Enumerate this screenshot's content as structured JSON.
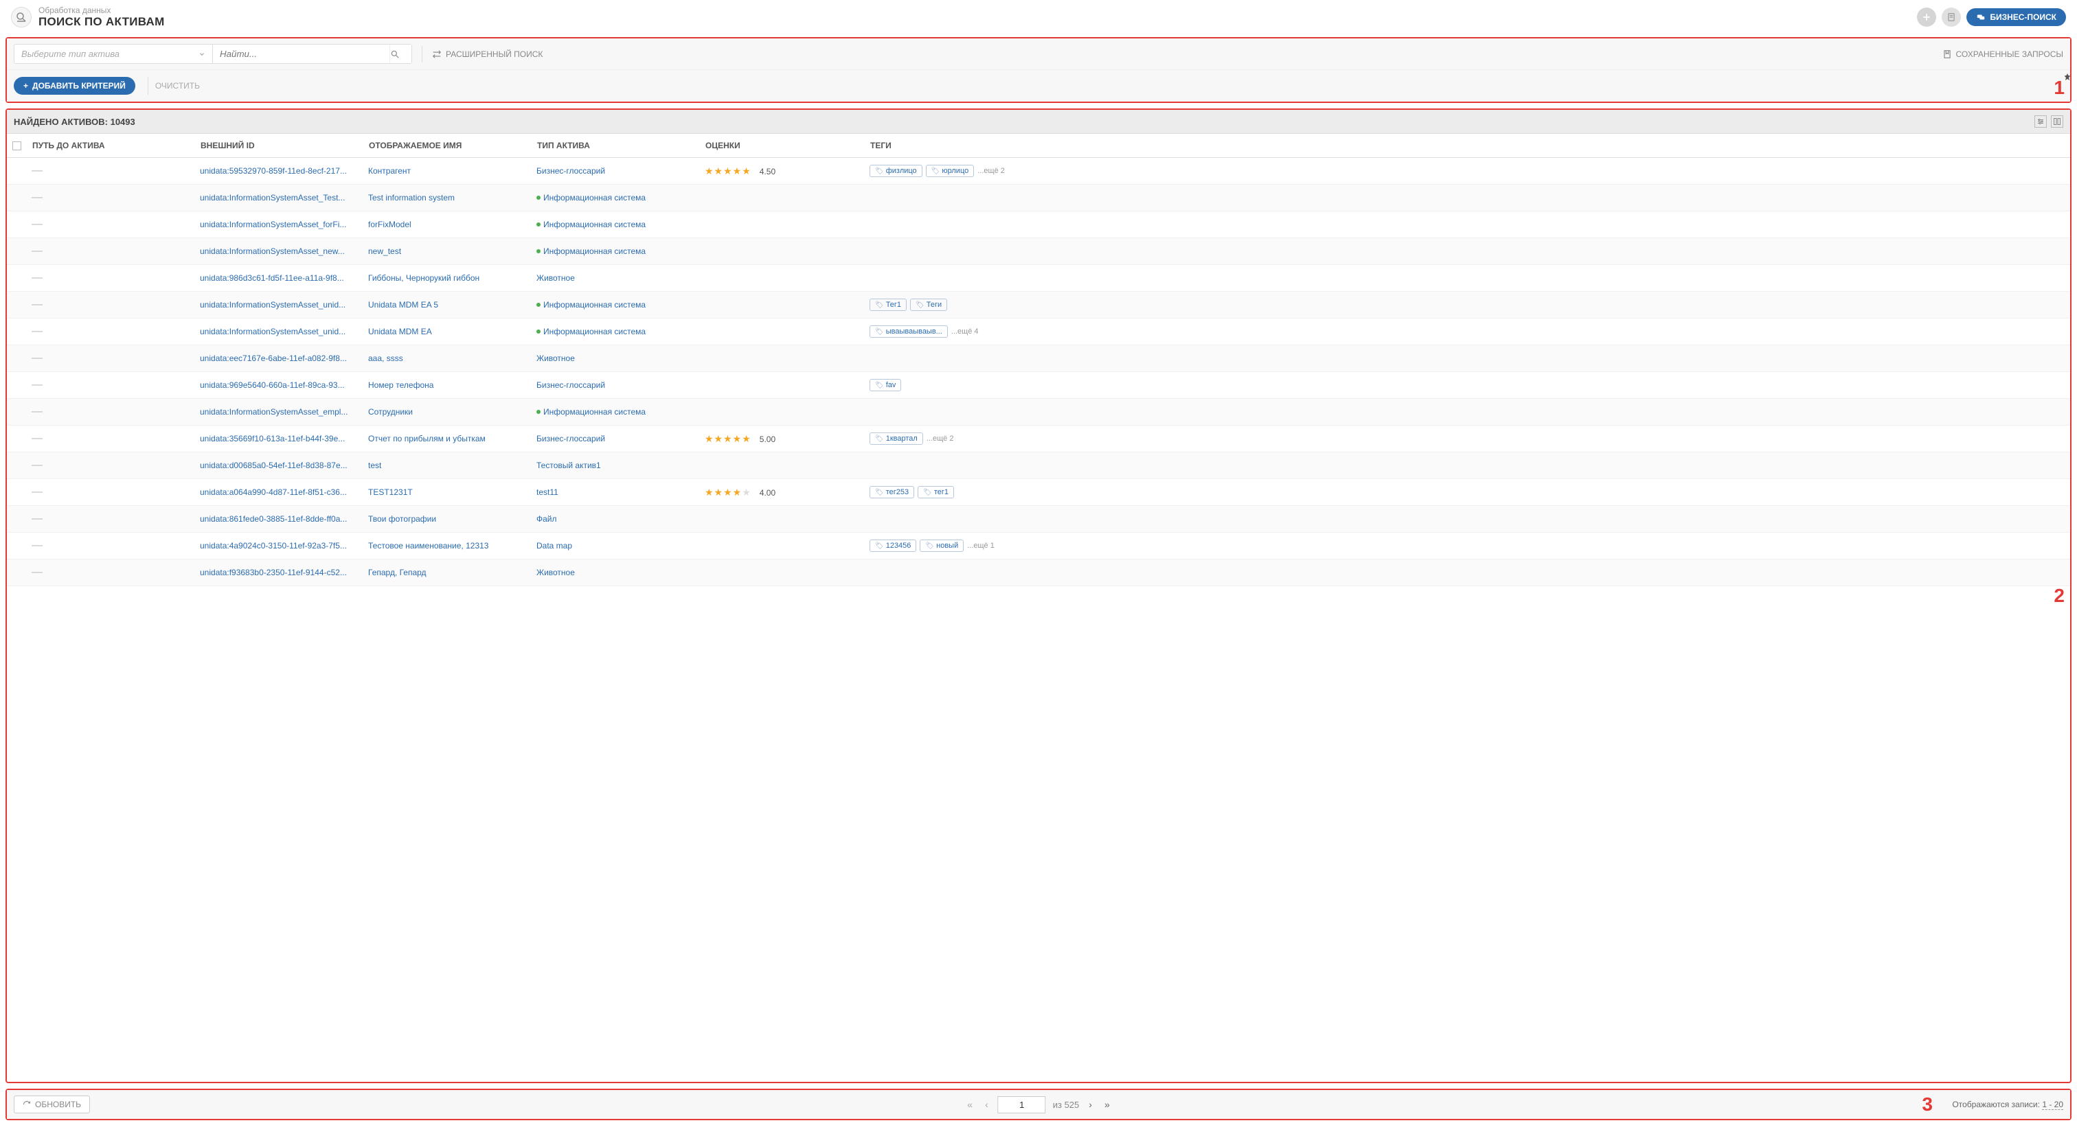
{
  "header": {
    "subtitle": "Обработка данных",
    "title": "ПОИСК ПО АКТИВАМ",
    "biz_search": "БИЗНЕС-ПОИСК"
  },
  "search": {
    "type_placeholder": "Выберите тип актива",
    "search_placeholder": "Найти...",
    "advanced": "РАСШИРЕННЫЙ ПОИСК",
    "saved": "СОХРАНЕННЫЕ ЗАПРОСЫ"
  },
  "criteria": {
    "add": "ДОБАВИТЬ КРИТЕРИЙ",
    "clear": "ОЧИСТИТЬ"
  },
  "results": {
    "count_label": "НАЙДЕНО АКТИВОВ: 10493"
  },
  "columns": {
    "path": "ПУТЬ ДО АКТИВА",
    "extid": "ВНЕШНИЙ ID",
    "name": "ОТОБРАЖАЕМОЕ ИМЯ",
    "type": "ТИП АКТИВА",
    "rating": "ОЦЕНКИ",
    "tags": "ТЕГИ"
  },
  "rows": [
    {
      "path": "—",
      "extid": "unidata:59532970-859f-11ed-8ecf-217...",
      "name": "Контрагент",
      "type": "Бизнес-глоссарий",
      "dot": false,
      "rating": 4.5,
      "rating_text": "4.50",
      "tags": [
        "физлицо",
        "юрлицо"
      ],
      "more": "...ещё 2"
    },
    {
      "path": "—",
      "extid": "unidata:InformationSystemAsset_Test...",
      "name": "Test information system",
      "type": "Информационная система",
      "dot": true,
      "rating": null,
      "rating_text": "",
      "tags": [],
      "more": ""
    },
    {
      "path": "—",
      "extid": "unidata:InformationSystemAsset_forFi...",
      "name": "forFixModel",
      "type": "Информационная система",
      "dot": true,
      "rating": null,
      "rating_text": "",
      "tags": [],
      "more": ""
    },
    {
      "path": "—",
      "extid": "unidata:InformationSystemAsset_new...",
      "name": "new_test",
      "type": "Информационная система",
      "dot": true,
      "rating": null,
      "rating_text": "",
      "tags": [],
      "more": ""
    },
    {
      "path": "—",
      "extid": "unidata:986d3c61-fd5f-11ee-a11a-9f8...",
      "name": "Гиббоны, Чернорукий гиббон",
      "type": "Животное",
      "dot": false,
      "rating": null,
      "rating_text": "",
      "tags": [],
      "more": ""
    },
    {
      "path": "—",
      "extid": "unidata:InformationSystemAsset_unid...",
      "name": "Unidata MDM EA 5",
      "type": "Информационная система",
      "dot": true,
      "rating": null,
      "rating_text": "",
      "tags": [
        "Тег1",
        "Теги"
      ],
      "more": ""
    },
    {
      "path": "—",
      "extid": "unidata:InformationSystemAsset_unid...",
      "name": "Unidata MDM EA",
      "type": "Информационная система",
      "dot": true,
      "rating": null,
      "rating_text": "",
      "tags": [
        "ываываываыв..."
      ],
      "more": "...ещё 4"
    },
    {
      "path": "—",
      "extid": "unidata:eec7167e-6abe-11ef-a082-9f8...",
      "name": "aaa, ssss",
      "type": "Животное",
      "dot": false,
      "rating": null,
      "rating_text": "",
      "tags": [],
      "more": ""
    },
    {
      "path": "—",
      "extid": "unidata:969e5640-660a-11ef-89ca-93...",
      "name": "Номер телефона",
      "type": "Бизнес-глоссарий",
      "dot": false,
      "rating": null,
      "rating_text": "",
      "tags": [
        "fav"
      ],
      "more": ""
    },
    {
      "path": "—",
      "extid": "unidata:InformationSystemAsset_empl...",
      "name": "Сотрудники",
      "type": "Информационная система",
      "dot": true,
      "rating": null,
      "rating_text": "",
      "tags": [],
      "more": ""
    },
    {
      "path": "—",
      "extid": "unidata:35669f10-613a-11ef-b44f-39e...",
      "name": "Отчет по прибылям и убыткам",
      "type": "Бизнес-глоссарий",
      "dot": false,
      "rating": 5.0,
      "rating_text": "5.00",
      "tags": [
        "1квартал"
      ],
      "more": "...ещё 2"
    },
    {
      "path": "—",
      "extid": "unidata:d00685a0-54ef-11ef-8d38-87e...",
      "name": "test",
      "type": "Тестовый актив1",
      "dot": false,
      "rating": null,
      "rating_text": "",
      "tags": [],
      "more": ""
    },
    {
      "path": "—",
      "extid": "unidata:a064a990-4d87-11ef-8f51-c36...",
      "name": "TEST1231T",
      "type": "test11",
      "dot": false,
      "rating": 4.0,
      "rating_text": "4.00",
      "tags": [
        "тег253",
        "тег1"
      ],
      "more": ""
    },
    {
      "path": "—",
      "extid": "unidata:861fede0-3885-11ef-8dde-ff0a...",
      "name": "Твои фотографии",
      "type": "Файл",
      "dot": false,
      "rating": null,
      "rating_text": "",
      "tags": [],
      "more": ""
    },
    {
      "path": "—",
      "extid": "unidata:4a9024c0-3150-11ef-92a3-7f5...",
      "name": "Тестовое наименование, 12313",
      "type": "Data map",
      "dot": false,
      "rating": null,
      "rating_text": "",
      "tags": [
        "123456",
        "новый"
      ],
      "more": "...ещё 1"
    },
    {
      "path": "—",
      "extid": "unidata:f93683b0-2350-11ef-9144-c52...",
      "name": "Гепард, Гепард",
      "type": "Животное",
      "dot": false,
      "rating": null,
      "rating_text": "",
      "tags": [],
      "more": ""
    }
  ],
  "footer": {
    "refresh": "ОБНОВИТЬ",
    "page": "1",
    "of": "из 525",
    "records_label": "Отображаются записи:",
    "records_range": "1 - 20"
  },
  "annotations": {
    "r1": "1",
    "r2": "2",
    "r3": "3"
  }
}
